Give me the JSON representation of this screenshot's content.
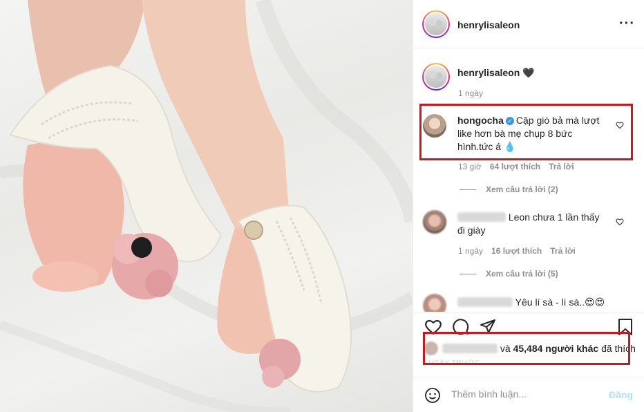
{
  "post": {
    "username": "henrylisaleon",
    "menu_icon": "more-icon",
    "caption_username": "henrylisaleon",
    "caption_text": "🖤",
    "caption_time": "1 ngày"
  },
  "comments": [
    {
      "username": "hongocha",
      "verified": true,
      "text": "Cặp giò bả mà lượt like hơn bà mẹ chụp 8 bức hình.tức á 💧",
      "time": "13 giờ",
      "likes": "64 lượt thích",
      "reply": "Trả lời",
      "view_replies": "Xem câu trả lời (2)"
    },
    {
      "username": "",
      "text": "Leon chưa 1 lần thấy đi giày",
      "time": "1 ngày",
      "likes": "16 lượt thích",
      "reply": "Trả lời",
      "view_replies": "Xem câu trả lời (5)"
    },
    {
      "username": "",
      "text": "Yêu lí sà - lì sà..😍😍"
    }
  ],
  "likes": {
    "and": "và",
    "count_text": "45,484 người khác",
    "suffix": "đã thích"
  },
  "date": "NGÀY TRƯỚC",
  "comment_box": {
    "placeholder": "Thêm bình luận...",
    "post_label": "Đăng"
  },
  "colors": {
    "highlight_border": "#d0151b",
    "verified": "#3897f0",
    "post_button": "#b2dffc"
  }
}
